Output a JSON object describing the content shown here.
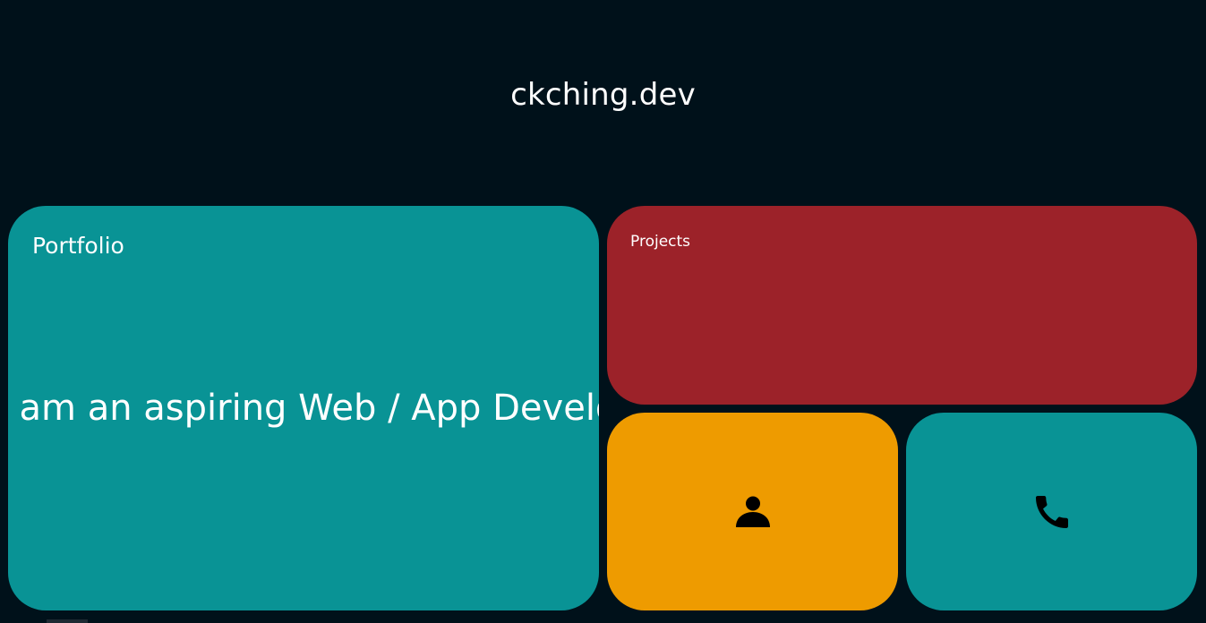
{
  "header": {
    "title": "ckching.dev"
  },
  "tiles": {
    "portfolio": {
      "label": "Portfolio",
      "marquee_text": "I am an aspiring Web / App Developer",
      "color": "#099395"
    },
    "projects": {
      "label": "Projects",
      "color": "#9c2229"
    },
    "about": {
      "icon": "person-icon",
      "color": "#ee9b00"
    },
    "contact": {
      "icon": "phone-icon",
      "color": "#099395"
    }
  },
  "colors": {
    "background": "#00111a",
    "text": "#ffffff",
    "icon": "#000000"
  }
}
